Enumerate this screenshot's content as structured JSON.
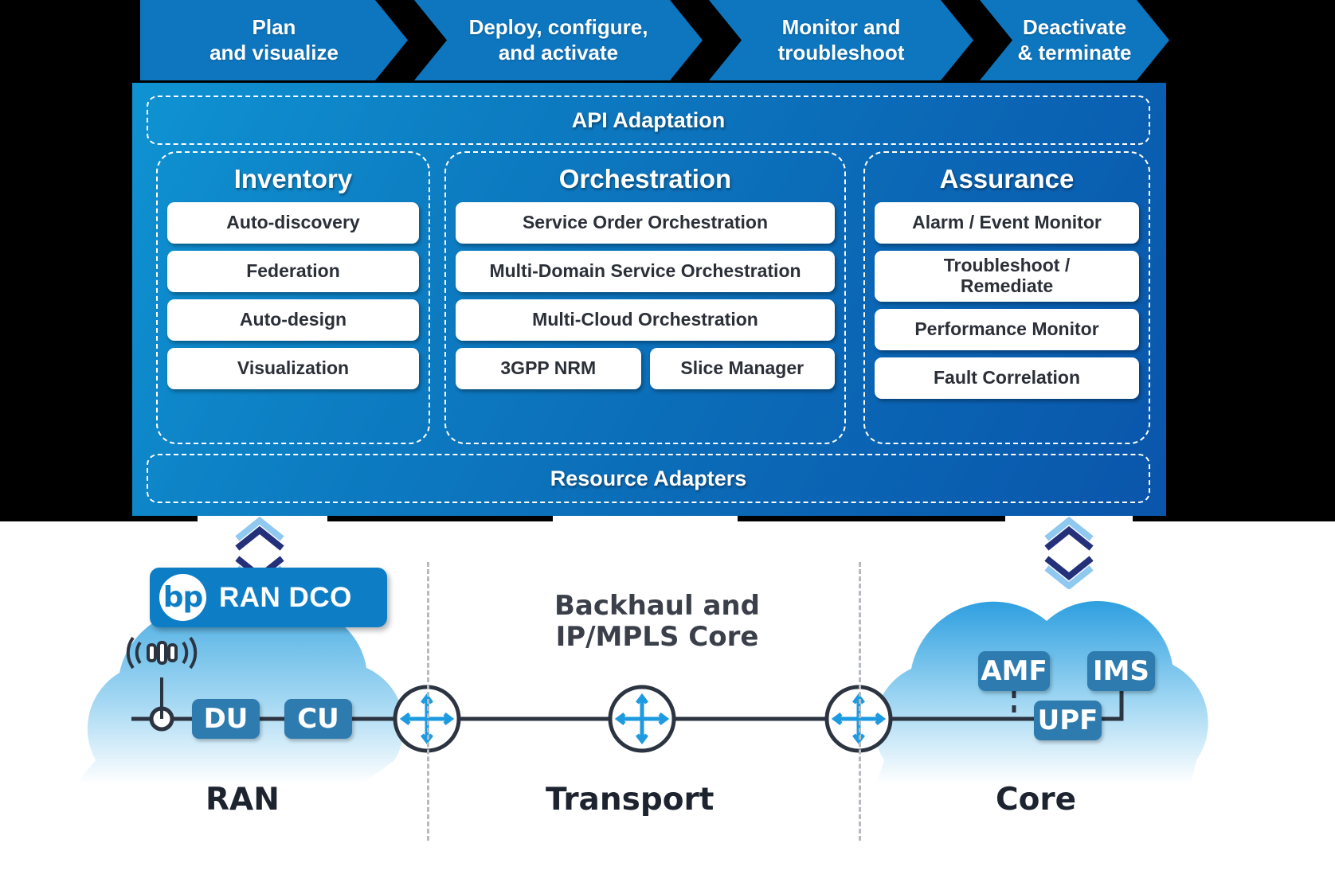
{
  "process_banner": {
    "steps": [
      {
        "line1": "Plan",
        "line2": "and visualize"
      },
      {
        "line1": "Deploy, configure,",
        "line2": "and activate"
      },
      {
        "line1": "Monitor and",
        "line2": "troubleshoot"
      },
      {
        "line1": "Deactivate",
        "line2": "& terminate"
      }
    ]
  },
  "platform": {
    "api_band": "API Adaptation",
    "resource_band": "Resource Adapters",
    "pillars": [
      {
        "title": "Inventory",
        "cards": [
          "Auto-discovery",
          "Federation",
          "Auto-design",
          "Visualization"
        ]
      },
      {
        "title": "Orchestration",
        "cards": [
          "Service Order Orchestration",
          "Multi-Domain Service Orchestration",
          "Multi-Cloud Orchestration"
        ],
        "card_row": [
          "3GPP NRM",
          "Slice Manager"
        ]
      },
      {
        "title": "Assurance",
        "cards": [
          "Alarm / Event Monitor",
          "Troubleshoot /\nRemediate",
          "Performance Monitor",
          "Fault Correlation"
        ]
      }
    ]
  },
  "badge": {
    "logo_text": "bp",
    "label": "RAN DCO"
  },
  "network": {
    "transport_title": "Backhaul and\nIP/MPLS Core",
    "segments": [
      "RAN",
      "Transport",
      "Core"
    ],
    "ran_nodes": [
      "DU",
      "CU"
    ],
    "core_nodes": [
      "AMF",
      "IMS",
      "UPF"
    ]
  },
  "colors": {
    "brand_blue": "#0d76bf",
    "panel_blue_light": "#0f93d2",
    "panel_blue_dark": "#0a55ab",
    "node_blue": "#2e7bb0",
    "cloud_blue": "#5bb3e4",
    "arrow_dark": "#24307a",
    "arrow_light": "#8fc9ef",
    "card_text": "#2b2f38"
  }
}
